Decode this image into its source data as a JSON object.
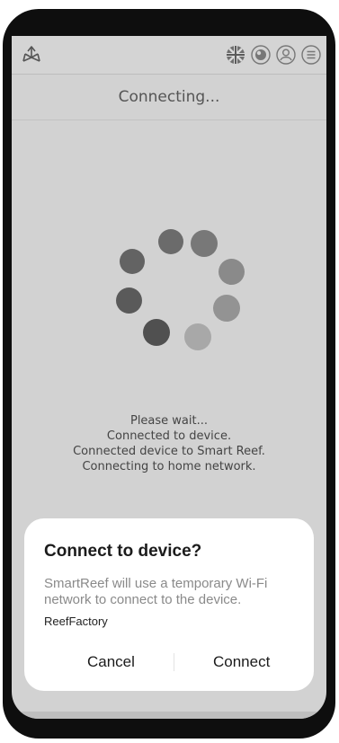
{
  "header": {
    "title": "Connecting..."
  },
  "status": {
    "lines": [
      "Please wait...",
      "Connected to device.",
      "Connected device to Smart Reef.",
      "Connecting to home network."
    ]
  },
  "dialog": {
    "title": "Connect to device?",
    "message": "SmartReef will use a temporary Wi-Fi network to connect to the device.",
    "network": "ReefFactory",
    "cancel_label": "Cancel",
    "connect_label": "Connect"
  },
  "colors": {
    "screen_dimmed": "#d2d2d2",
    "dialog_bg": "#ffffff",
    "navbar_bg": "#bebebe"
  },
  "icons": {
    "header": [
      "reef-logo-icon",
      "uk-flag-icon",
      "globe-icon",
      "user-icon",
      "menu-icon"
    ],
    "navbar": [
      "recent-apps-icon",
      "home-icon",
      "back-icon"
    ]
  }
}
